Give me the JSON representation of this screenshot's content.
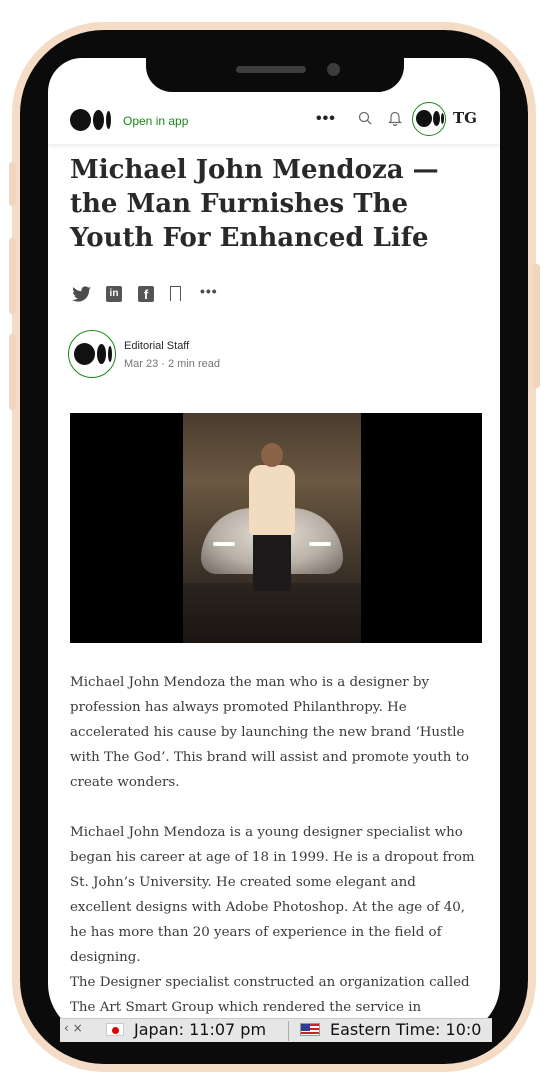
{
  "header": {
    "open_in_app": "Open in app",
    "more_icon": "more-icon",
    "search_icon": "search-icon",
    "bell_icon": "bell-icon",
    "publication_logo": "TG"
  },
  "article": {
    "title": "Michael John Mendoza — the Man Furnishes The Youth For Enhanced Life",
    "share_icons": [
      "twitter-icon",
      "linkedin-icon",
      "facebook-icon",
      "bookmark-icon",
      "more-icon"
    ],
    "author": "Editorial Staff",
    "meta": "Mar 23 · 2 min read",
    "paragraphs": [
      "Michael John Mendoza the man who is a designer by profession has always promoted Philanthropy. He accelerated his cause by launching the new brand ‘Hustle with The God’. This brand will assist and promote youth to create wonders.",
      "Michael John Mendoza is a young designer specialist who began his career at age of 18 in 1999. He is a dropout from St. John’s University. He created some elegant and excellent designs with Adobe Photoshop. At the age of 40, he has more than 20 years of experience in the field of designing.",
      "The Designer specialist constructed an organization called The Art Smart Group which rendered the service in"
    ]
  },
  "taskbar": {
    "japan_time": "Japan: 11:07 pm",
    "eastern_time": "Eastern Time: 10:0"
  },
  "colors": {
    "accent_green": "#1a8917",
    "frame_outline": "#f4dcc6"
  }
}
